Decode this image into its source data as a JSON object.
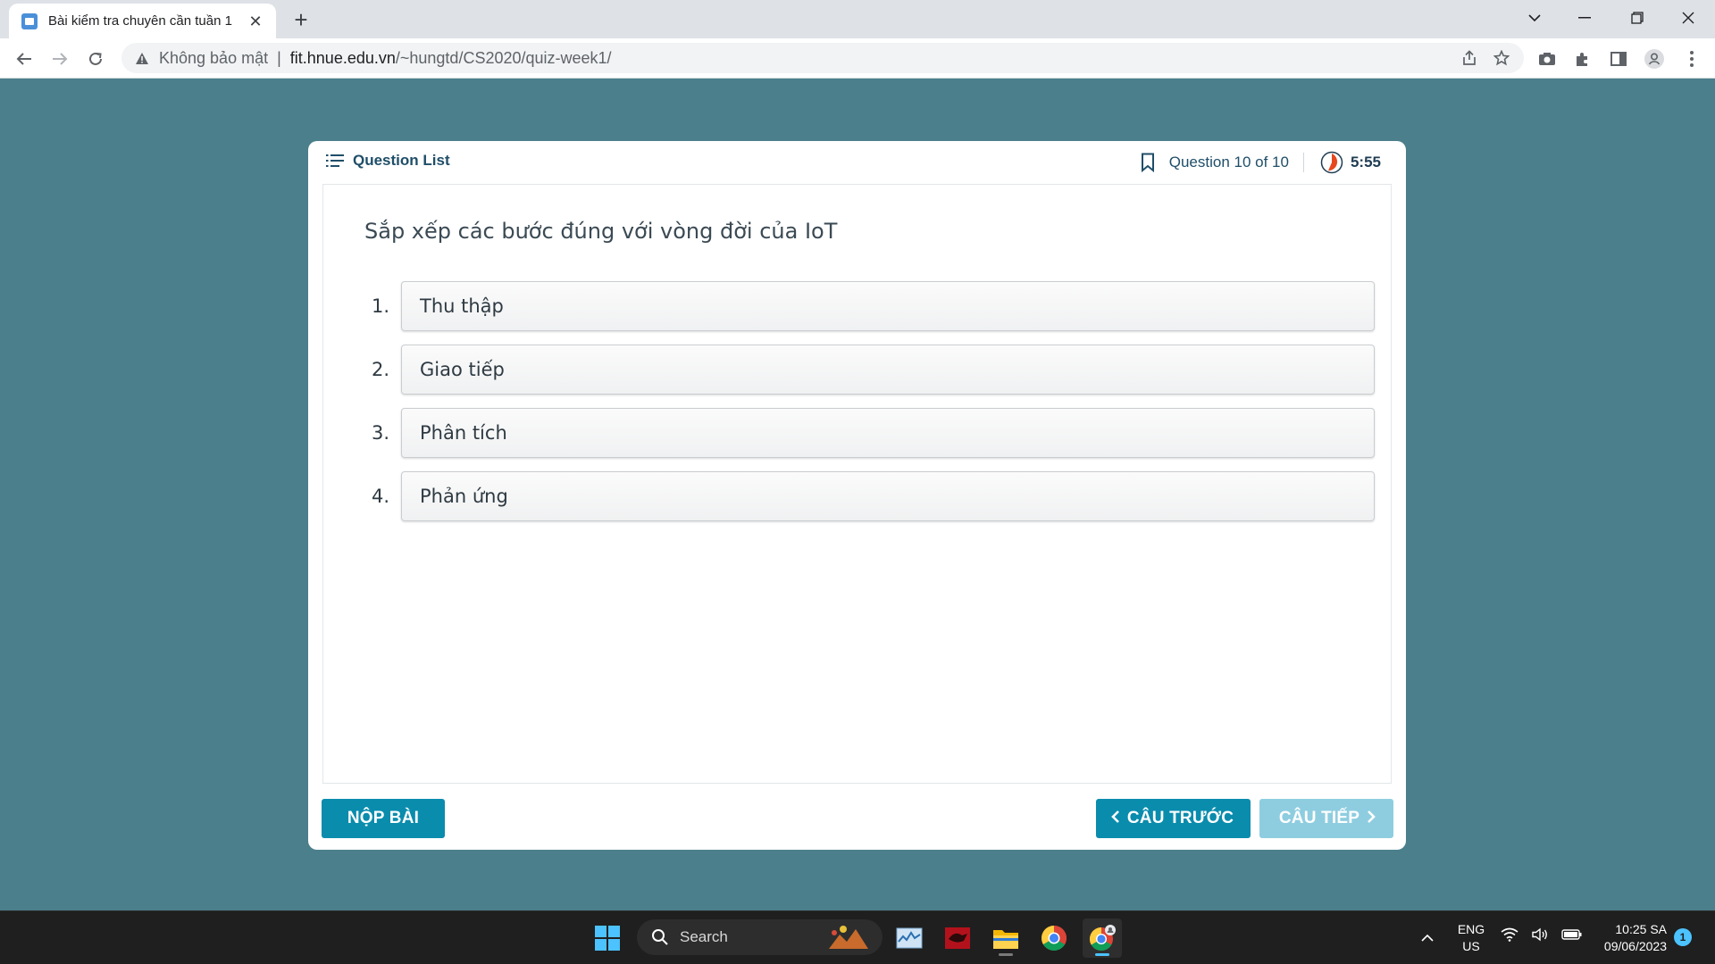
{
  "browser": {
    "tab_title": "Bài kiểm tra chuyên cần tuần 1",
    "security_label": "Không bảo mật",
    "url_host": "fit.hnue.edu.vn",
    "url_path": "/~hungtd/CS2020/quiz-week1/"
  },
  "quiz": {
    "question_list_label": "Question List",
    "question_counter": "Question 10 of 10",
    "timer": "5:55",
    "question_text": "Sắp xếp các bước đúng với vòng đời của IoT",
    "answers": [
      {
        "num": "1.",
        "text": "Thu thập"
      },
      {
        "num": "2.",
        "text": "Giao tiếp"
      },
      {
        "num": "3.",
        "text": "Phân tích"
      },
      {
        "num": "4.",
        "text": "Phản ứng"
      }
    ],
    "submit_label": "NỘP BÀI",
    "prev_label": "CÂU TRƯỚC",
    "next_label": "CÂU TIẾP",
    "next_disabled": true
  },
  "taskbar": {
    "search_label": "Search",
    "language": "ENG",
    "region": "US",
    "time": "10:25 SA",
    "date": "09/06/2023",
    "notification_count": "1"
  },
  "colors": {
    "page_bg": "#4a7f8b",
    "primary_button": "#0a8cad",
    "disabled_button": "#8ecde0",
    "heading_text": "#1f4e68",
    "timer_accent": "#e8461e"
  },
  "icons": [
    "back-arrow-icon",
    "forward-arrow-icon",
    "reload-icon",
    "warning-icon",
    "share-icon",
    "star-icon",
    "camera-icon",
    "extensions-icon",
    "side-panel-icon",
    "profile-icon",
    "menu-dots-icon",
    "list-icon",
    "bookmark-icon",
    "timer-icon",
    "chevron-left-icon",
    "chevron-right-icon",
    "windows-start-icon",
    "search-icon",
    "chrome-icon",
    "file-explorer-icon",
    "wifi-icon",
    "volume-icon",
    "battery-icon"
  ]
}
